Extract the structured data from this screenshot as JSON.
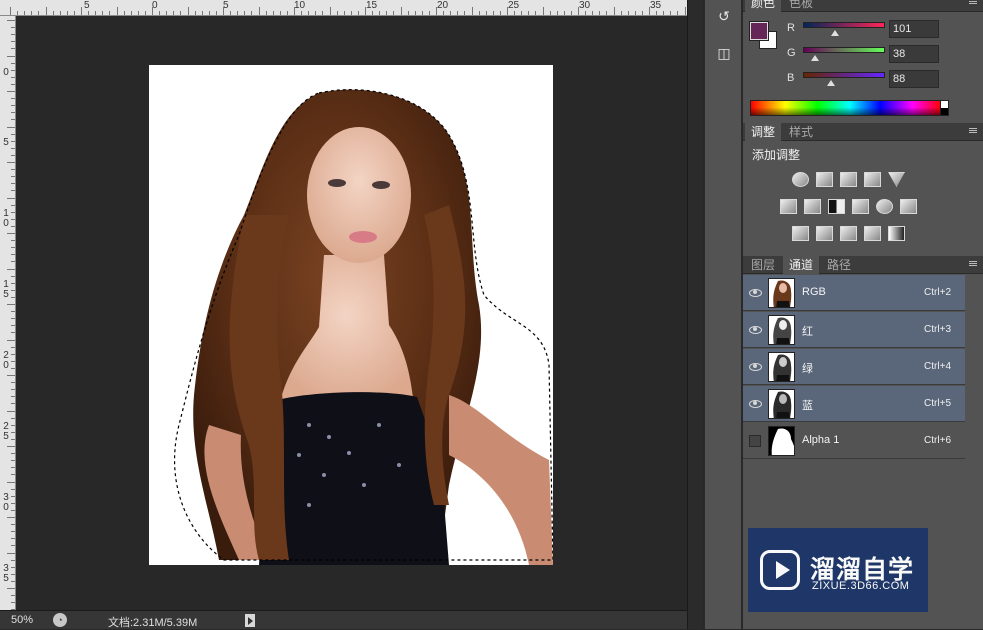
{
  "rulers": {
    "top_labels": [
      "5",
      "0",
      "5",
      "10",
      "15",
      "20",
      "25",
      "30",
      "35"
    ],
    "left_labels": [
      "0",
      "5",
      "10",
      "15",
      "20",
      "25",
      "30",
      "35"
    ]
  },
  "status": {
    "zoom": "50%",
    "doc_info": "文档:2.31M/5.39M"
  },
  "color_panel": {
    "tabs": [
      "颜色",
      "色板"
    ],
    "foreground": "#652658",
    "background": "#ffffff",
    "channels": [
      {
        "label": "R",
        "value": "101"
      },
      {
        "label": "G",
        "value": "38"
      },
      {
        "label": "B",
        "value": "88"
      }
    ]
  },
  "adjustments_panel": {
    "tabs": [
      "调整",
      "样式"
    ],
    "title": "添加调整",
    "icons": [
      [
        "brightness-contrast-icon",
        "levels-icon",
        "curves-icon",
        "exposure-icon",
        "vibrance-icon"
      ],
      [
        "hue-saturation-icon",
        "color-balance-icon",
        "black-white-icon",
        "photo-filter-icon",
        "channel-mixer-icon",
        "color-lookup-icon"
      ],
      [
        "invert-icon",
        "posterize-icon",
        "threshold-icon",
        "selective-color-icon",
        "gradient-map-icon"
      ]
    ]
  },
  "channels_panel": {
    "tabs": [
      "图层",
      "通道",
      "路径"
    ],
    "rows": [
      {
        "name": "RGB",
        "shortcut": "Ctrl+2",
        "visible": true,
        "selected": true
      },
      {
        "name": "红",
        "shortcut": "Ctrl+3",
        "visible": true,
        "selected": true
      },
      {
        "name": "绿",
        "shortcut": "Ctrl+4",
        "visible": true,
        "selected": true
      },
      {
        "name": "蓝",
        "shortcut": "Ctrl+5",
        "visible": true,
        "selected": true
      },
      {
        "name": "Alpha 1",
        "shortcut": "Ctrl+6",
        "visible": false,
        "selected": false
      }
    ]
  },
  "watermark": {
    "title": "溜溜自学",
    "url": "ZIXUE.3D66.COM"
  }
}
